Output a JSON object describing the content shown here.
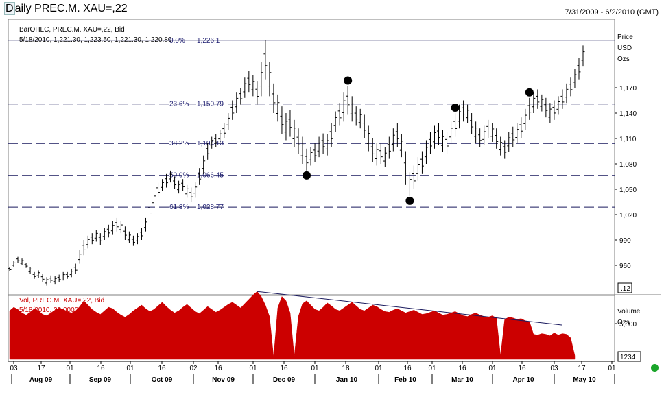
{
  "window": {
    "title": "Daily PREC.M. XAU=,22",
    "date_range": "7/31/2009 - 6/2/2010 (GMT)"
  },
  "price_panel": {
    "legend_line1": "BarOHLC, PREC.M. XAU=,22, Bid",
    "legend_line2": "5/18/2010, 1,221.30, 1,223.50, 1,221.30, 1,220.80",
    "axis_title": [
      "Price",
      "USD",
      "Ozs"
    ],
    "current_value_box": ".12"
  },
  "volume_panel": {
    "legend_line1": "Vol, PREC.M. XAU=,22, Bid",
    "legend_line2": "5/18/2010, 33.0000",
    "axis_title": [
      "Volume",
      "Ozs"
    ],
    "value_box": "1234"
  },
  "colors": {
    "bars": "#000000",
    "fib_lines": "#1a1a5e",
    "fib_labels": "#1a1a6e",
    "volume_fill": "#cc0000",
    "volume_legend": "#cc0000",
    "trendline": "#1a1a5e",
    "status_dot": "#1aa52a"
  },
  "chart_data": [
    {
      "type": "ohlc",
      "panel": "price",
      "ylim": [
        930,
        1240
      ],
      "yticks": [
        960,
        990,
        1020,
        1050,
        1080,
        1110,
        1140,
        1170
      ],
      "ytick_labels": [
        "960",
        "990",
        "1,020",
        "1,050",
        "1,080",
        "1,110",
        "1,140",
        "1,170"
      ],
      "fibonacci": [
        {
          "pct": "0.0%",
          "value": 1226.1,
          "label": "1,226.1"
        },
        {
          "pct": "23.6%",
          "value": 1150.79,
          "label": "1,150.79"
        },
        {
          "pct": "38.2%",
          "value": 1104.13,
          "label": "1,104.13"
        },
        {
          "pct": "50.0%",
          "value": 1066.45,
          "label": "1,066.45"
        },
        {
          "pct": "61.8%",
          "value": 1028.77,
          "label": "1,028.77"
        }
      ],
      "x_day_labels": [
        "03",
        "17",
        "01",
        "16",
        "01",
        "16",
        "02",
        "16",
        "01",
        "16",
        "01",
        "18",
        "01",
        "16",
        "01",
        "16",
        "01",
        "16",
        "03",
        "17",
        "01"
      ],
      "x_month_labels": [
        "Aug 09",
        "Sep 09",
        "Oct 09",
        "Nov 09",
        "Dec 09",
        "Jan 10",
        "Feb 10",
        "Mar 10",
        "Apr 10",
        "May 10"
      ],
      "bars": [
        [
          953,
          958
        ],
        [
          958,
          965
        ],
        [
          963,
          970
        ],
        [
          960,
          968
        ],
        [
          957,
          963
        ],
        [
          950,
          958
        ],
        [
          944,
          952
        ],
        [
          945,
          954
        ],
        [
          940,
          950
        ],
        [
          936,
          946
        ],
        [
          939,
          948
        ],
        [
          938,
          947
        ],
        [
          940,
          949
        ],
        [
          942,
          952
        ],
        [
          944,
          952
        ],
        [
          946,
          956
        ],
        [
          950,
          962
        ],
        [
          962,
          978
        ],
        [
          972,
          990
        ],
        [
          980,
          995
        ],
        [
          985,
          998
        ],
        [
          988,
          1002
        ],
        [
          984,
          998
        ],
        [
          990,
          1004
        ],
        [
          993,
          1008
        ],
        [
          996,
          1012
        ],
        [
          1000,
          1016
        ],
        [
          998,
          1012
        ],
        [
          990,
          1006
        ],
        [
          986,
          1000
        ],
        [
          983,
          995
        ],
        [
          985,
          998
        ],
        [
          990,
          1004
        ],
        [
          1000,
          1016
        ],
        [
          1015,
          1035
        ],
        [
          1028,
          1048
        ],
        [
          1040,
          1058
        ],
        [
          1048,
          1062
        ],
        [
          1052,
          1068
        ],
        [
          1058,
          1072
        ],
        [
          1050,
          1065
        ],
        [
          1045,
          1060
        ],
        [
          1048,
          1062
        ],
        [
          1040,
          1055
        ],
        [
          1035,
          1052
        ],
        [
          1040,
          1058
        ],
        [
          1055,
          1075
        ],
        [
          1068,
          1090
        ],
        [
          1085,
          1105
        ],
        [
          1098,
          1112
        ],
        [
          1100,
          1115
        ],
        [
          1105,
          1120
        ],
        [
          1110,
          1128
        ],
        [
          1120,
          1140
        ],
        [
          1132,
          1155
        ],
        [
          1140,
          1165
        ],
        [
          1150,
          1170
        ],
        [
          1158,
          1182
        ],
        [
          1165,
          1190
        ],
        [
          1160,
          1185
        ],
        [
          1150,
          1178
        ],
        [
          1160,
          1200
        ],
        [
          1180,
          1226
        ],
        [
          1160,
          1200
        ],
        [
          1140,
          1175
        ],
        [
          1130,
          1162
        ],
        [
          1115,
          1148
        ],
        [
          1108,
          1140
        ],
        [
          1112,
          1144
        ],
        [
          1100,
          1132
        ],
        [
          1092,
          1122
        ],
        [
          1080,
          1112
        ],
        [
          1072,
          1098
        ],
        [
          1078,
          1100
        ],
        [
          1082,
          1104
        ],
        [
          1088,
          1112
        ],
        [
          1092,
          1116
        ],
        [
          1090,
          1115
        ],
        [
          1100,
          1128
        ],
        [
          1118,
          1142
        ],
        [
          1125,
          1152
        ],
        [
          1130,
          1165
        ],
        [
          1138,
          1172
        ],
        [
          1130,
          1160
        ],
        [
          1125,
          1148
        ],
        [
          1122,
          1145
        ],
        [
          1110,
          1138
        ],
        [
          1095,
          1125
        ],
        [
          1082,
          1110
        ],
        [
          1078,
          1105
        ],
        [
          1080,
          1104
        ],
        [
          1076,
          1100
        ],
        [
          1086,
          1112
        ],
        [
          1095,
          1122
        ],
        [
          1100,
          1128
        ],
        [
          1088,
          1115
        ],
        [
          1055,
          1095
        ],
        [
          1042,
          1070
        ],
        [
          1050,
          1078
        ],
        [
          1060,
          1088
        ],
        [
          1068,
          1095
        ],
        [
          1080,
          1108
        ],
        [
          1092,
          1118
        ],
        [
          1098,
          1125
        ],
        [
          1102,
          1128
        ],
        [
          1094,
          1120
        ],
        [
          1092,
          1118
        ],
        [
          1104,
          1130
        ],
        [
          1112,
          1140
        ],
        [
          1122,
          1150
        ],
        [
          1130,
          1155
        ],
        [
          1128,
          1150
        ],
        [
          1115,
          1140
        ],
        [
          1105,
          1130
        ],
        [
          1100,
          1122
        ],
        [
          1102,
          1125
        ],
        [
          1110,
          1132
        ],
        [
          1106,
          1128
        ],
        [
          1098,
          1122
        ],
        [
          1090,
          1112
        ],
        [
          1086,
          1108
        ],
        [
          1094,
          1118
        ],
        [
          1100,
          1124
        ],
        [
          1104,
          1128
        ],
        [
          1110,
          1135
        ],
        [
          1120,
          1145
        ],
        [
          1132,
          1158
        ],
        [
          1140,
          1165
        ],
        [
          1145,
          1168
        ],
        [
          1142,
          1162
        ],
        [
          1135,
          1158
        ],
        [
          1128,
          1152
        ],
        [
          1132,
          1155
        ],
        [
          1138,
          1160
        ],
        [
          1145,
          1168
        ],
        [
          1152,
          1175
        ],
        [
          1160,
          1182
        ],
        [
          1170,
          1192
        ],
        [
          1180,
          1205
        ],
        [
          1195,
          1220
        ]
      ]
    },
    {
      "type": "area",
      "panel": "volume",
      "ylim": [
        0,
        10000
      ],
      "yticks": [
        5000
      ],
      "ytick_labels": [
        "5,000"
      ],
      "trendline": {
        "from_bar": 60,
        "from_value": 9500,
        "to_bar": 134,
        "to_value": 4800
      },
      "values": [
        6800,
        7300,
        7000,
        6500,
        6200,
        6600,
        7100,
        6800,
        6300,
        6100,
        6500,
        6900,
        7200,
        7000,
        6700,
        6500,
        6800,
        7400,
        8200,
        7600,
        7000,
        6600,
        6300,
        6800,
        7300,
        7100,
        6600,
        6200,
        5900,
        6300,
        6800,
        7200,
        7600,
        7100,
        6700,
        7000,
        7500,
        8000,
        7400,
        6900,
        6500,
        6800,
        7300,
        7700,
        7200,
        6700,
        6400,
        6900,
        7400,
        7000,
        6600,
        6900,
        7300,
        7700,
        8000,
        7600,
        7200,
        7800,
        8400,
        9000,
        9500,
        8800,
        7600,
        6000,
        300,
        7200,
        8800,
        8200,
        6500,
        400,
        6000,
        7800,
        8200,
        7600,
        7000,
        6800,
        7300,
        7900,
        7500,
        7000,
        6800,
        7200,
        7600,
        8000,
        7500,
        7000,
        6800,
        7200,
        7600,
        7400,
        7000,
        6700,
        6600,
        6900,
        7100,
        6800,
        6500,
        6700,
        6900,
        6600,
        6300,
        6400,
        6600,
        6800,
        6500,
        6200,
        6300,
        6500,
        6700,
        6400,
        6100,
        6000,
        6300,
        6500,
        6200,
        6000,
        5900,
        6100,
        5800,
        500,
        5600,
        5900,
        5800,
        5600,
        5700,
        5400,
        5300,
        3500,
        3400,
        3600,
        3500,
        3300,
        3700,
        3400,
        3600,
        3500,
        3000,
        500
      ]
    }
  ]
}
